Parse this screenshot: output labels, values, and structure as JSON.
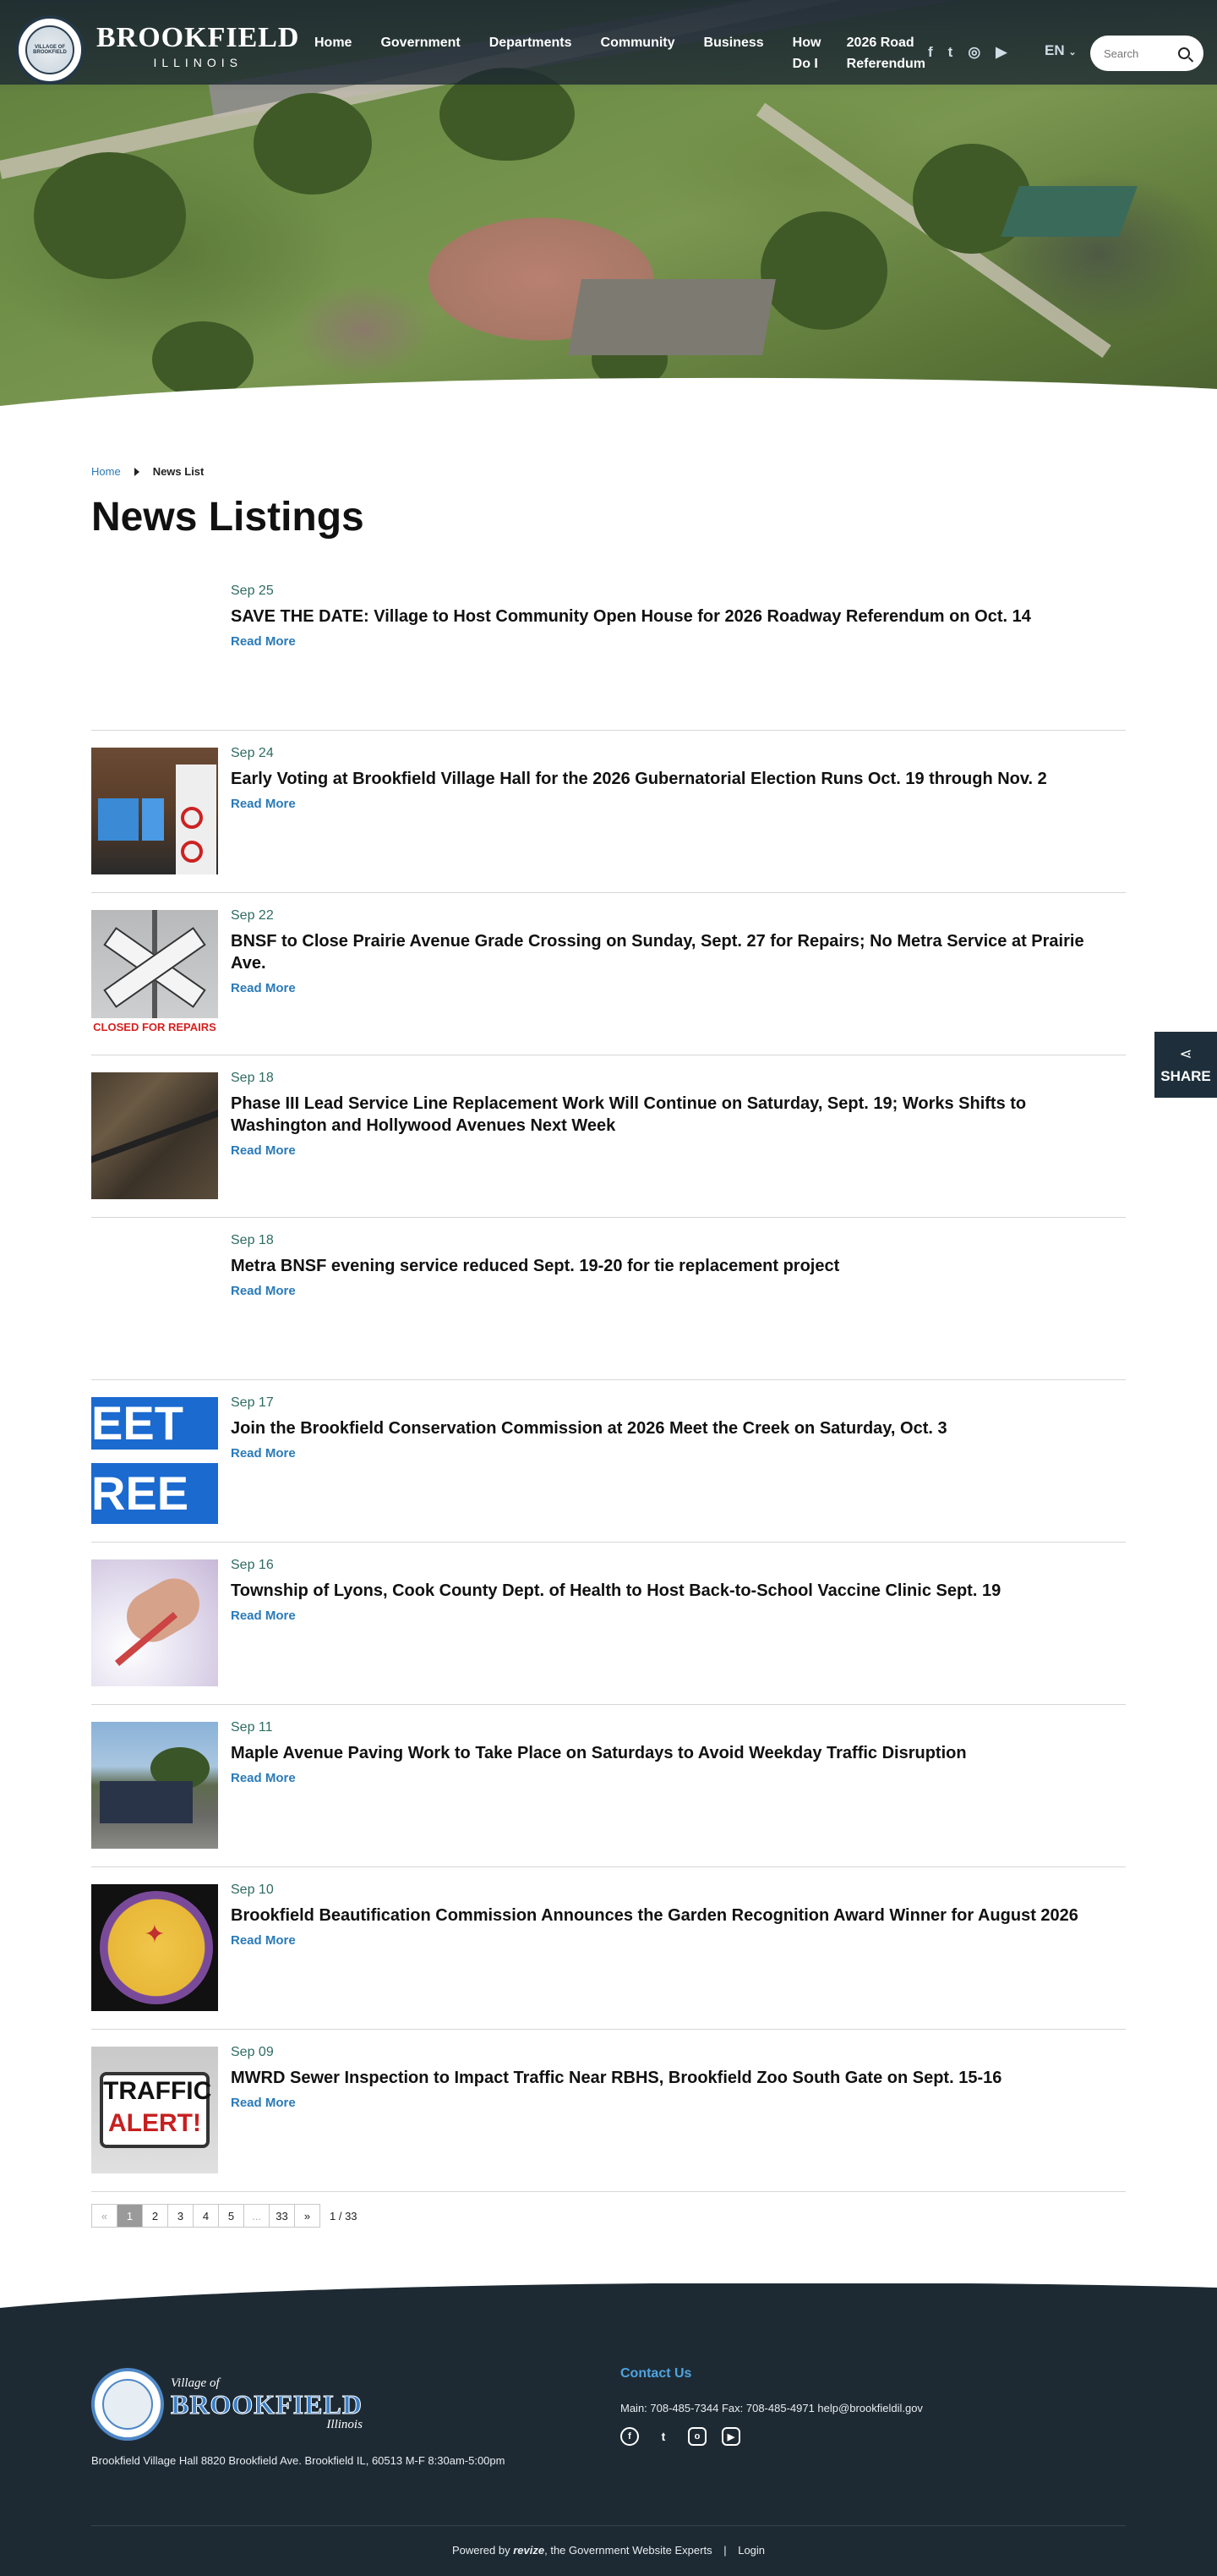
{
  "header": {
    "logo_text": "VILLAGE OF BROOKFIELD",
    "brand_name": "BROOKFIELD",
    "brand_state": "ILLINOIS",
    "nav": [
      {
        "label": "Home"
      },
      {
        "label": "Government"
      },
      {
        "label": "Departments"
      },
      {
        "label": "Community"
      },
      {
        "label": "Business"
      },
      {
        "label": "How Do I"
      },
      {
        "label": "2026 Road Referendum"
      }
    ],
    "social": [
      "facebook-icon",
      "twitter-icon",
      "instagram-icon",
      "youtube-icon"
    ],
    "language": "EN",
    "search_placeholder": "Search"
  },
  "breadcrumb": {
    "home": "Home",
    "current": "News List"
  },
  "page_title": "News Listings",
  "news": [
    {
      "date": "Sep 25",
      "title": "SAVE THE DATE: Village to Host Community Open House for 2026 Roadway Referendum on Oct. 14",
      "read_more": "Read More",
      "image": "none"
    },
    {
      "date": "Sep 24",
      "title": "Early Voting at Brookfield Village Hall for the 2026 Gubernatorial Election Runs Oct. 19 through Nov. 2",
      "read_more": "Read More",
      "image": "vote"
    },
    {
      "date": "Sep 22",
      "title": "BNSF to Close Prairie Avenue Grade Crossing on Sunday, Sept. 27 for Repairs; No Metra Service at Prairie Ave.",
      "read_more": "Read More",
      "image": "rail",
      "image_text": "CLOSED FOR REPAIRS"
    },
    {
      "date": "Sep 18",
      "title": "Phase III Lead Service Line Replacement Work Will Continue on Saturday, Sept. 19; Works Shifts to Washington and Hollywood Avenues Next Week",
      "read_more": "Read More",
      "image": "lead"
    },
    {
      "date": "Sep 18",
      "title": "Metra BNSF evening service reduced Sept. 19-20 for tie replacement project",
      "read_more": "Read More",
      "image": "none"
    },
    {
      "date": "Sep 17",
      "title": "Join the Brookfield Conservation Commission at 2026 Meet the Creek on Saturday, Oct. 3",
      "read_more": "Read More",
      "image": "meet",
      "image_text_1": "EET",
      "image_text_2": "REE"
    },
    {
      "date": "Sep 16",
      "title": "Township of Lyons, Cook County Dept. of Health to Host Back-to-School Vaccine Clinic Sept. 19",
      "read_more": "Read More",
      "image": "vaccine"
    },
    {
      "date": "Sep 11",
      "title": "Maple Avenue Paving Work to Take Place on Saturdays to Avoid Weekday Traffic Disruption",
      "read_more": "Read More",
      "image": "paving"
    },
    {
      "date": "Sep 10",
      "title": "Brookfield Beautification Commission Announces the Garden Recognition Award Winner for August 2026",
      "read_more": "Read More",
      "image": "beautification"
    },
    {
      "date": "Sep 09",
      "title": "MWRD Sewer Inspection to Impact Traffic Near RBHS, Brookfield Zoo South Gate on Sept. 15-16",
      "read_more": "Read More",
      "image": "traffic",
      "image_text_1": "TRAFFIC",
      "image_text_2": "ALERT!"
    }
  ],
  "pagination": {
    "prev": "«",
    "pages": [
      "1",
      "2",
      "3",
      "4",
      "5",
      "...",
      "33"
    ],
    "next": "»",
    "info": "1 / 33",
    "current": "1"
  },
  "share": {
    "label": "SHARE"
  },
  "footer": {
    "logo_village_of": "Village of",
    "logo_name": "BROOKFIELD",
    "logo_state": "Illinois",
    "address": "Brookfield Village Hall 8820 Brookfield Ave. Brookfield IL, 60513 M-F 8:30am-5:00pm",
    "contact_heading": "Contact Us",
    "contact_line": "Main: 708-485-7344 Fax: 708-485-4971 help@brookfieldil.gov",
    "social": [
      "facebook-icon",
      "twitter-icon",
      "instagram-icon",
      "youtube-icon"
    ],
    "powered_prefix": "Powered by",
    "powered_brand": "revize",
    "powered_suffix": ", the Government Website Experts",
    "login": "Login"
  },
  "colors": {
    "accent_link": "#2a7ab8",
    "date_green": "#2e6b62",
    "footer_bg": "#1e2a33",
    "contact_heading": "#4fa4e0"
  }
}
